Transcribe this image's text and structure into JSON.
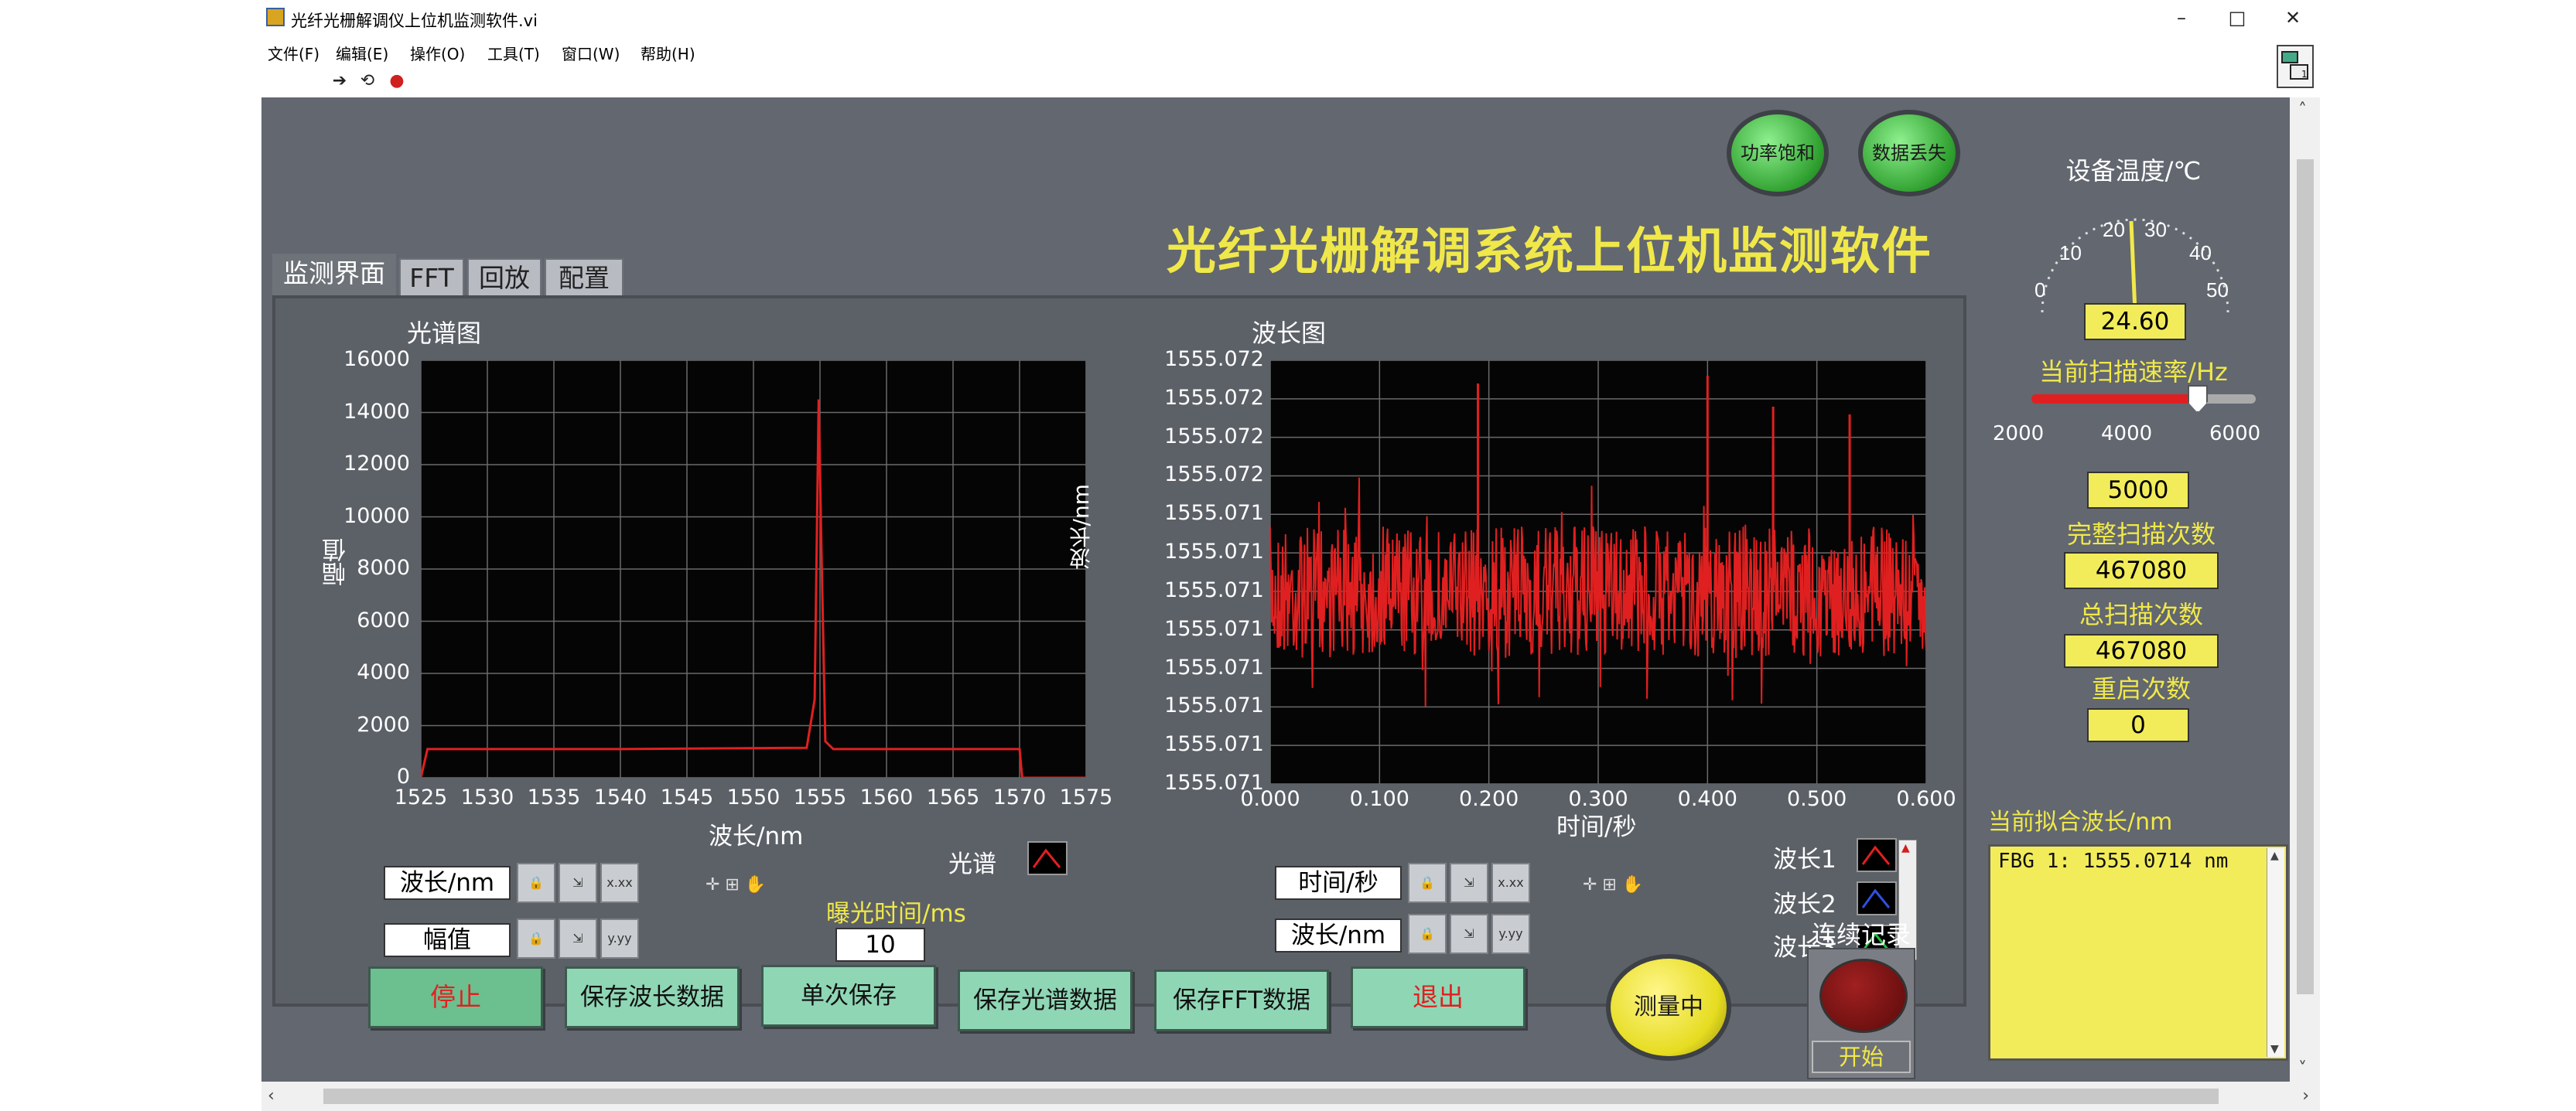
{
  "window": {
    "title": "光纤光栅解调仪上位机监测软件.vi",
    "controls": {
      "minimize": "–",
      "maximize": "□",
      "close": "✕"
    }
  },
  "menu": [
    "文件(F)",
    "编辑(E)",
    "操作(O)",
    "工具(T)",
    "窗口(W)",
    "帮助(H)"
  ],
  "toolbar": {
    "icons": [
      "run-arrow-icon",
      "run-continuous-icon",
      "abort-icon"
    ]
  },
  "header": {
    "title": "光纤光栅解调系统上位机监测软件",
    "indicators": [
      {
        "label": "功率饱和",
        "color": "#3db83d"
      },
      {
        "label": "数据丢失",
        "color": "#3db83d"
      }
    ]
  },
  "tabs": [
    {
      "label": "监测界面",
      "active": true
    },
    {
      "label": "FFT",
      "active": false
    },
    {
      "label": "回放",
      "active": false
    },
    {
      "label": "配置",
      "active": false
    }
  ],
  "spectrum_chart": {
    "title": "光谱图",
    "xlabel": "波长/nm",
    "ylabel": "幅值",
    "x_ticks": [
      "1525",
      "1530",
      "1535",
      "1540",
      "1545",
      "1550",
      "1555",
      "1560",
      "1565",
      "1570",
      "1575"
    ],
    "y_ticks": [
      "16000",
      "14000",
      "12000",
      "10000",
      "8000",
      "6000",
      "4000",
      "2000",
      "0"
    ],
    "legend": "光谱",
    "scale_x_label": "波长/nm",
    "scale_y_label": "幅值",
    "exposure_label": "曝光时间/ms",
    "exposure_value": "10"
  },
  "wavelength_chart": {
    "title": "波长图",
    "xlabel": "时间/秒",
    "ylabel": "波长/nm",
    "x_ticks": [
      "0.000",
      "0.100",
      "0.200",
      "0.300",
      "0.400",
      "0.500",
      "0.600"
    ],
    "y_ticks": [
      "1555.072",
      "1555.072",
      "1555.072",
      "1555.072",
      "1555.071",
      "1555.071",
      "1555.071",
      "1555.071",
      "1555.071",
      "1555.071",
      "1555.071",
      "1555.071"
    ],
    "scale_x_label": "时间/秒",
    "scale_y_label": "波长/nm",
    "legend": [
      {
        "label": "波长1",
        "color": "#e02020"
      },
      {
        "label": "波长2",
        "color": "#3050e0"
      },
      {
        "label": "波长3",
        "color": "#20c040"
      }
    ]
  },
  "chart_data": [
    {
      "type": "line",
      "title": "光谱图",
      "xlabel": "波长/nm",
      "ylabel": "幅值",
      "xlim": [
        1525,
        1575
      ],
      "ylim": [
        0,
        16000
      ],
      "grid": true,
      "series": [
        {
          "name": "光谱",
          "color": "#e02020",
          "x": [
            1525,
            1525.5,
            1540,
            1554.0,
            1554.6,
            1554.9,
            1555.1,
            1555.4,
            1556.0,
            1565,
            1570,
            1570.2,
            1575
          ],
          "y": [
            0,
            1100,
            1100,
            1150,
            3000,
            14500,
            9000,
            1400,
            1100,
            1100,
            1100,
            0,
            0
          ]
        }
      ]
    },
    {
      "type": "line",
      "title": "波长图",
      "xlabel": "时间/秒",
      "ylabel": "波长/nm",
      "xlim": [
        0,
        0.6
      ],
      "grid": true,
      "series": [
        {
          "name": "波长1",
          "color": "#e02020",
          "x": [
            0.0,
            0.1,
            0.2,
            0.3,
            0.4,
            0.45,
            0.46,
            0.5,
            0.6
          ],
          "y": [
            1555.0713,
            1555.0713,
            1555.0713,
            1555.0713,
            1555.0713,
            1555.0713,
            1555.0715,
            1555.0713,
            1555.0713
          ]
        }
      ]
    }
  ],
  "right_panel": {
    "temp_label": "设备温度/℃",
    "temp_gauge_ticks": [
      "0",
      "10",
      "20",
      "30",
      "40",
      "50"
    ],
    "temp_value": "24.60",
    "scan_rate_label": "当前扫描速率/Hz",
    "scan_slider_ticks": [
      "2000",
      "4000",
      "6000"
    ],
    "scan_rate_value": "5000",
    "full_scans_label": "完整扫描次数",
    "full_scans_value": "467080",
    "total_scans_label": "总扫描次数",
    "total_scans_value": "467080",
    "restarts_label": "重启次数",
    "restarts_value": "0",
    "fit_label": "当前拟合波长/nm",
    "fit_text": "FBG 1:  1555.0714 nm"
  },
  "bottom_buttons": {
    "stop": "停止",
    "save_wavelength": "保存波长数据",
    "single_save": "单次保存",
    "save_spectrum": "保存光谱数据",
    "save_fft": "保存FFT数据",
    "exit": "退出",
    "measuring": "测量中",
    "continuous_label": "连续记录",
    "start": "开始"
  }
}
